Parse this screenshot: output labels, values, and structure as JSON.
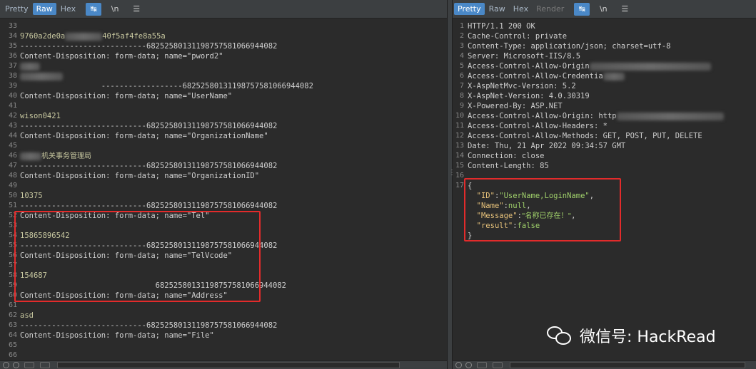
{
  "left_toolbar": {
    "tabs": [
      "Pretty",
      "Raw",
      "Hex"
    ],
    "active_tab": "Raw",
    "newline_label": "\\n",
    "wrap_icon": "wrap-icon",
    "menu_icon": "menu-icon"
  },
  "right_toolbar": {
    "tabs": [
      "Pretty",
      "Raw",
      "Hex",
      "Render"
    ],
    "active_tab": "Pretty",
    "newline_label": "\\n",
    "wrap_icon": "wrap-icon",
    "menu_icon": "menu-icon"
  },
  "request": {
    "line_numbers": [
      "33",
      "34",
      "35",
      "36",
      "37",
      "38",
      "39",
      "40",
      "41",
      "42",
      "43",
      "44",
      "45",
      "46",
      "47",
      "48",
      "49",
      "50",
      "51",
      "52",
      "53",
      "54",
      "55",
      "56",
      "57",
      "58",
      "59",
      "60",
      "61",
      "62",
      "63",
      "64",
      "65",
      "66"
    ],
    "l34_prefix": "9760a2de0a",
    "l34_suffix": "40f5af4fe8a55a",
    "boundary": "----------------------------682525801311987575810669440​82",
    "boundary_full": "------------------------------682525801311987575810669440 82",
    "cd_pword2": "Content-Disposition: form-data; name=\"pword2\"",
    "cd_username": "Content-Disposition: form-data; name=\"UserName\"",
    "val_username": "wison0421",
    "cd_orgname": "Content-Disposition: form-data; name=\"OrganizationName\"",
    "val_orgname": "机关事务管理局",
    "cd_orgid": "Content-Disposition: form-data; name=\"OrganizationID\"",
    "val_orgid": "10375",
    "cd_tel": "Content-Disposition: form-data; name=\"Tel\"",
    "val_tel": "15865896542",
    "cd_telvcode": "Content-Disposition: form-data; name=\"TelVcode\"",
    "val_telvcode": "154687",
    "cd_address": "Content-Disposition: form-data; name=\"Address\"",
    "val_address": "asd",
    "cd_file": "Content-Disposition: form-data; name=\"File\""
  },
  "response": {
    "line_numbers": [
      "1",
      "2",
      "3",
      "4",
      "5",
      "6",
      "7",
      "8",
      "9",
      "10",
      "11",
      "12",
      "13",
      "14",
      "15",
      "16",
      "17"
    ],
    "status": "HTTP/1.1 200 OK",
    "cache_control": "Cache-Control: private",
    "content_type": "Content-Type: application/json; charset=utf-8",
    "server": "Server: Microsoft-IIS/8.5",
    "acao_prefix": "Access-Control-Allow-Origin",
    "acac_prefix": "Access-Control-Allow-Credentia",
    "mvc_version": "X-AspNetMvc-Version: 5.2",
    "aspnet_version": "X-AspNet-Version: 4.0.30319",
    "powered_by": "X-Powered-By: ASP.NET",
    "acao2_prefix": "Access-Control-Allow-Origin: http",
    "acah": "Access-Control-Allow-Headers: *",
    "acam": "Access-Control-Allow-Methods: GET, POST, PUT, DELETE",
    "date": "Date: Thu, 21 Apr 2022 09:34:57 GMT",
    "connection": "Connection: close",
    "content_length": "Content-Length: 85",
    "json_open": "{",
    "json_close": "}",
    "json_id_key": "\"ID\"",
    "json_id_val": "\"UserName,LoginName\"",
    "json_name_key": "\"Name\"",
    "json_name_val": "null",
    "json_msg_key": "\"Message\"",
    "json_msg_val": "\"名称已存在！\"",
    "json_result_key": "\"result\"",
    "json_result_val": "false"
  },
  "watermark": {
    "text": "微信号: HackRead",
    "logo_icon": "wechat-icon"
  },
  "colors": {
    "highlight": "#e22b2b",
    "active_tab": "#4a88c7",
    "background": "#2b2b2b"
  }
}
